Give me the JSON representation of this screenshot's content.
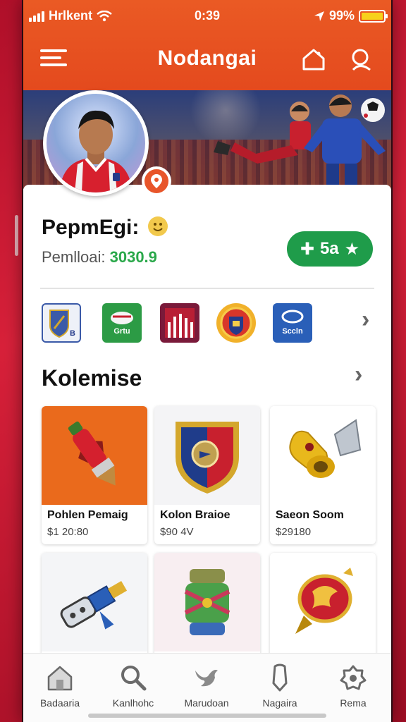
{
  "status": {
    "carrier": "Hrlkent",
    "time": "0:39",
    "battery": "99%",
    "battery_level": 0.99
  },
  "header": {
    "title": "Nodangai",
    "menu_icon": "hamburger-icon",
    "home_icon": "home-icon",
    "search_icon": "search-icon"
  },
  "profile": {
    "name": "PepmEgi:",
    "subtitle_label": "Pemlloai:",
    "subtitle_value": "3030.9",
    "pill_label": "5a",
    "location_icon": "location-pin-icon"
  },
  "badges": [
    {
      "text": "B",
      "color": "#3b5aa8"
    },
    {
      "text": "Grtu",
      "color": "#2c9b45"
    },
    {
      "text": "",
      "color": "#b81f35"
    },
    {
      "text": "",
      "color": "#d8362a"
    },
    {
      "text": "Sccln",
      "color": "#2a5fb8"
    }
  ],
  "section": {
    "title": "Kolemise"
  },
  "items": [
    {
      "name": "Pohlen Pemaig",
      "price": "$1 20:80",
      "icon": "rocket-icon",
      "bg": "#ea6a1c"
    },
    {
      "name": "Kolon Braioe",
      "price": "$90 4V",
      "icon": "shield-icon",
      "bg": "#f4f4f6"
    },
    {
      "name": "Saeon Soom",
      "price": "$29180",
      "icon": "trumpet-icon",
      "bg": "#ffffff"
    },
    {
      "name": "",
      "price": "",
      "icon": "tool-icon",
      "bg": "#f4f5f7"
    },
    {
      "name": "",
      "price": "",
      "icon": "lantern-icon",
      "bg": "#f8eef1"
    },
    {
      "name": "",
      "price": "",
      "icon": "emblem-icon",
      "bg": "#ffffff"
    }
  ],
  "nav": [
    {
      "label": "Badaaria",
      "icon": "home-icon"
    },
    {
      "label": "Kanlhohc",
      "icon": "search-icon"
    },
    {
      "label": "Marudoan",
      "icon": "bird-icon"
    },
    {
      "label": "Nagaira",
      "icon": "pencil-icon"
    },
    {
      "label": "Rema",
      "icon": "settings-icon"
    }
  ]
}
